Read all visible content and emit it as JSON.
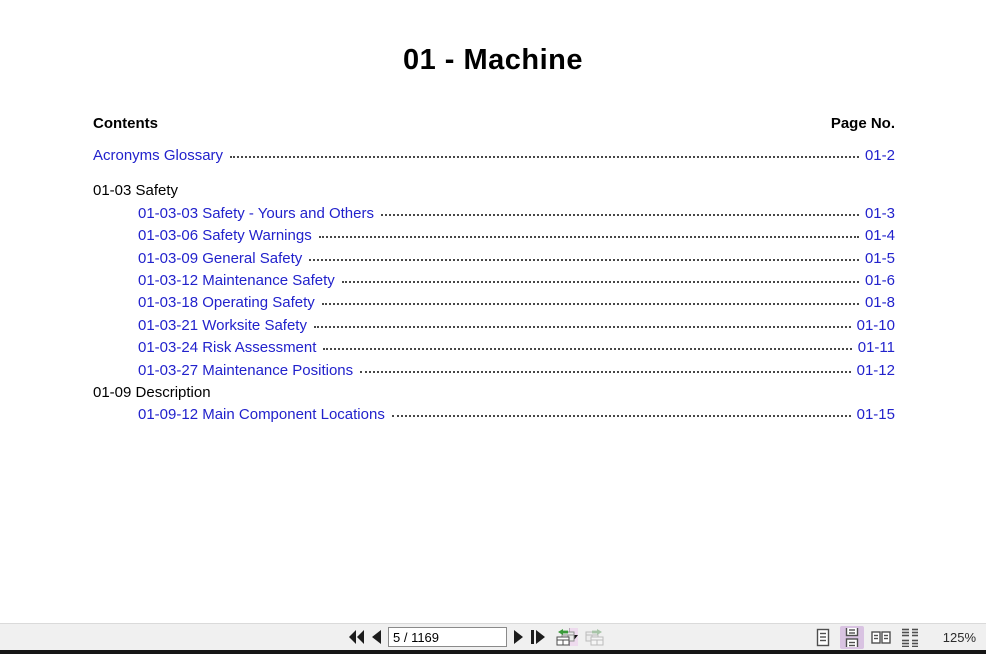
{
  "document": {
    "title": "01 - Machine",
    "contents_label": "Contents",
    "page_no_label": "Page No.",
    "entries": [
      {
        "label": "Acronyms Glossary",
        "page": "01-2",
        "level": 0,
        "link": true,
        "gap_before": false
      },
      {
        "label": "01-03 Safety",
        "page": "",
        "level": 0,
        "link": false,
        "gap_before": true
      },
      {
        "label": "01-03-03 Safety - Yours and Others",
        "page": "01-3",
        "level": 1,
        "link": true,
        "gap_before": false
      },
      {
        "label": "01-03-06 Safety Warnings",
        "page": "01-4",
        "level": 1,
        "link": true,
        "gap_before": false
      },
      {
        "label": "01-03-09 General Safety",
        "page": "01-5",
        "level": 1,
        "link": true,
        "gap_before": false
      },
      {
        "label": "01-03-12 Maintenance Safety",
        "page": "01-6",
        "level": 1,
        "link": true,
        "gap_before": false
      },
      {
        "label": "01-03-18 Operating Safety",
        "page": "01-8",
        "level": 1,
        "link": true,
        "gap_before": false
      },
      {
        "label": "01-03-21 Worksite Safety",
        "page": "01-10",
        "level": 1,
        "link": true,
        "gap_before": false
      },
      {
        "label": "01-03-24 Risk Assessment",
        "page": "01-11",
        "level": 1,
        "link": true,
        "gap_before": false
      },
      {
        "label": "01-03-27 Maintenance Positions",
        "page": "01-12",
        "level": 1,
        "link": true,
        "gap_before": false
      },
      {
        "label": "01-09 Description",
        "page": "",
        "level": 0,
        "link": false,
        "gap_before": false
      },
      {
        "label": "01-09-12 Main Component Locations",
        "page": "01-15",
        "level": 1,
        "link": true,
        "gap_before": false
      }
    ]
  },
  "statusbar": {
    "page_input_value": "5 / 1169",
    "zoom_level": "125%"
  },
  "colors": {
    "link_blue": "#2222cc",
    "selected_layout_bg": "#d9c3e2",
    "statusbar_bg": "#f0f0f0"
  }
}
